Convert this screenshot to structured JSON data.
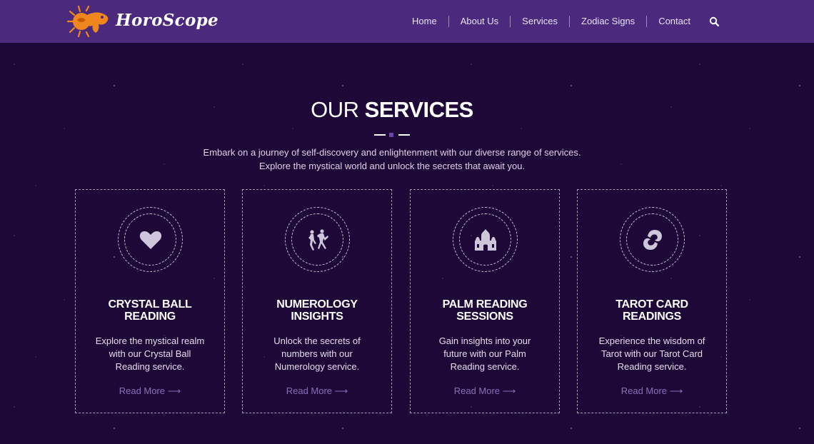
{
  "header": {
    "brand": "HoroScope",
    "nav": [
      "Home",
      "About Us",
      "Services",
      "Zodiac Signs",
      "Contact"
    ]
  },
  "section": {
    "title_light": "OUR",
    "title_bold": "SERVICES",
    "subtitle_line1": "Embark on a journey of self-discovery and enlightenment with our diverse range of services.",
    "subtitle_line2": "Explore the mystical world and unlock the secrets that await you."
  },
  "services": [
    {
      "icon": "heart-icon",
      "title_line1": "CRYSTAL BALL",
      "title_line2": "READING",
      "desc_line1": "Explore the mystical realm",
      "desc_line2": "with our Crystal Ball",
      "desc_line3": "Reading service.",
      "link": "Read More ⟶"
    },
    {
      "icon": "dancers-icon",
      "title_line1": "NUMEROLOGY",
      "title_line2": "INSIGHTS",
      "desc_line1": "Unlock the secrets of",
      "desc_line2": "numbers with our",
      "desc_line3": "Numerology service.",
      "link": "Read More ⟶"
    },
    {
      "icon": "palace-icon",
      "title_line1": "PALM READING",
      "title_line2": "SESSIONS",
      "desc_line1": "Gain insights into your",
      "desc_line2": "future with our Palm",
      "desc_line3": "Reading service.",
      "link": "Read More ⟶"
    },
    {
      "icon": "pisces-icon",
      "title_line1": "TAROT CARD",
      "title_line2": "READINGS",
      "desc_line1": "Experience the wisdom of",
      "desc_line2": "Tarot with our Tarot Card",
      "desc_line3": "Reading service.",
      "link": "Read More ⟶"
    }
  ],
  "colors": {
    "header_bg": "#4b2a7e",
    "page_bg": "#1d0838",
    "accent": "#8a6fb8",
    "logo_orange": "#f0861e"
  }
}
